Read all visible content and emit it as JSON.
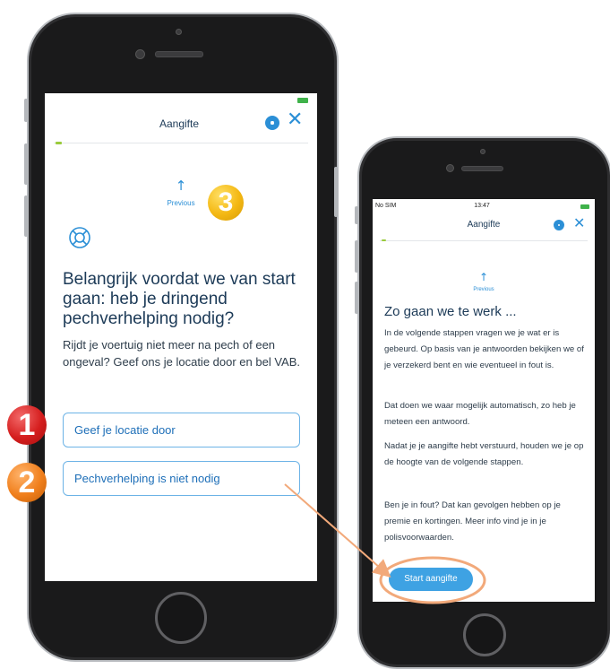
{
  "left_phone": {
    "header_title": "Aangifte",
    "close_icon": "close-x-icon",
    "chat_icon": "chat-bubble-icon",
    "previous_label": "Previous",
    "heading": "Belangrijk voordat we van start gaan: heb je dringend pechverhelping nodig?",
    "body": "Rijdt je voertuig niet meer na pech of een ongeval? Geef ons je locatie door en bel VAB.",
    "options": [
      {
        "label": "Geef je locatie door"
      },
      {
        "label": "Pechverhelping is niet nodig"
      }
    ]
  },
  "right_phone": {
    "status": {
      "carrier": "No SIM",
      "time": "13:47"
    },
    "header_title": "Aangifte",
    "previous_label": "Previous",
    "heading": "Zo gaan we te werk ...",
    "paragraphs": [
      "In de volgende stappen vragen we je wat er is gebeurd. Op basis van je antwoorden bekijken we of je verzekerd bent en wie eventueel in fout is.",
      "Dat doen we waar mogelijk automatisch, zo heb je meteen een antwoord.",
      "Nadat je je aangifte hebt verstuurd, houden we je op de hoogte van de volgende stappen.",
      "Ben je in fout? Dat kan gevolgen hebben op je premie en kortingen. Meer info vind je in je polisvoorwaarden."
    ],
    "start_button": "Start aangifte"
  },
  "annotations": {
    "badges": [
      "1",
      "2",
      "3"
    ],
    "colors": {
      "badge_1": "#d51e1e",
      "badge_2": "#f07f1c",
      "badge_3": "#f4b813",
      "arrow": "#f2a97a",
      "ellipse": "#f2a97a"
    }
  },
  "colors": {
    "accent": "#2b8fd6",
    "heading": "#1c3a57",
    "progress": "#9acb3c",
    "button": "#3ea2e3"
  }
}
